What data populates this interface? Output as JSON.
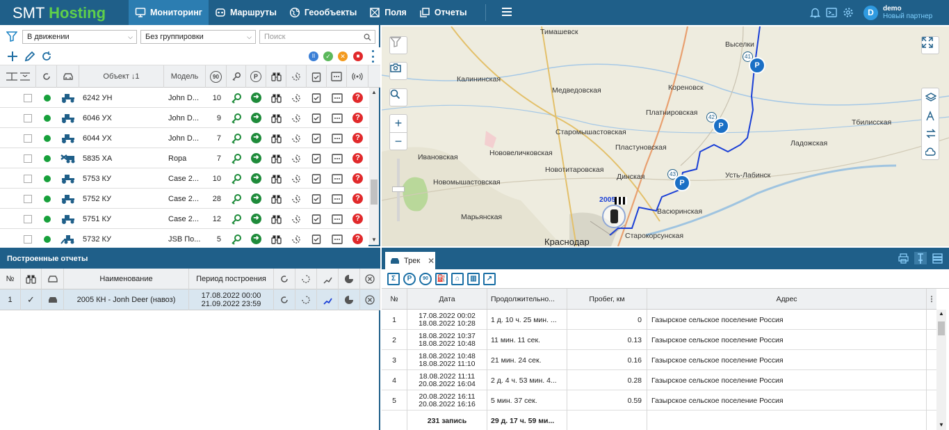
{
  "app": {
    "logo_a": "SMT ",
    "logo_b": "Hosting"
  },
  "nav": [
    {
      "label": "Мониторинг",
      "icon": "monitor-icon",
      "active": true
    },
    {
      "label": "Маршруты",
      "icon": "route-icon"
    },
    {
      "label": "Геообъекты",
      "icon": "globe-icon"
    },
    {
      "label": "Поля",
      "icon": "fields-icon"
    },
    {
      "label": "Отчеты",
      "icon": "reports-icon"
    }
  ],
  "user": {
    "initial": "D",
    "name": "demo",
    "role": "Новый партнер"
  },
  "filters": {
    "status": "В движении",
    "grouping": "Без группировки",
    "search_placeholder": "Поиск"
  },
  "objects_table": {
    "headers": {
      "object": "Объект ↓1",
      "model": "Модель",
      "speed": "90"
    },
    "rows": [
      {
        "name": "6242 УН",
        "model": "John D...",
        "val": "10",
        "icon": "tractor-icon"
      },
      {
        "name": "6046 УХ",
        "model": "John D...",
        "val": "9",
        "icon": "tractor-icon"
      },
      {
        "name": "6044 УХ",
        "model": "John D...",
        "val": "7",
        "icon": "tractor-icon"
      },
      {
        "name": "5835 ХА",
        "model": "Ropa",
        "val": "7",
        "icon": "harvester-icon"
      },
      {
        "name": "5753 КУ",
        "model": "Case 2...",
        "val": "10",
        "icon": "tractor-icon"
      },
      {
        "name": "5752 КУ",
        "model": "Case 2...",
        "val": "28",
        "icon": "tractor-icon"
      },
      {
        "name": "5751 КУ",
        "model": "Case 2...",
        "val": "12",
        "icon": "tractor-icon"
      },
      {
        "name": "5732 КУ",
        "model": "JSB По...",
        "val": "5",
        "icon": "loader-icon"
      }
    ]
  },
  "map": {
    "labels": [
      {
        "t": "Тимашевск"
      },
      {
        "t": "Выселки"
      },
      {
        "t": "Калининская"
      },
      {
        "t": "Медведовская"
      },
      {
        "t": "Кореновск"
      },
      {
        "t": "Платнировская"
      },
      {
        "t": "Тбилисская"
      },
      {
        "t": "Старомышастовская"
      },
      {
        "t": "Нововеличковская"
      },
      {
        "t": "Пластуновская"
      },
      {
        "t": "Ладожская"
      },
      {
        "t": "Ивановская"
      },
      {
        "t": "Новотитаровская"
      },
      {
        "t": "Динская"
      },
      {
        "t": "Усть-Лабинск"
      },
      {
        "t": "Новомышастовская"
      },
      {
        "t": "Васюринская"
      },
      {
        "t": "Марьянская"
      },
      {
        "t": "Краснодар"
      },
      {
        "t": "Старокорсунская"
      }
    ],
    "markers": [
      "41",
      "42",
      "43"
    ],
    "vehicle_label": "2005 КН"
  },
  "reports": {
    "title": "Построенные отчеты",
    "headers": {
      "num": "№",
      "name": "Наименование",
      "period": "Период построения"
    },
    "rows": [
      {
        "num": "1",
        "name": "2005 КН - Jonh Deer (навоз)",
        "from": "17.08.2022 00:00",
        "to": "21.09.2022 23:59"
      }
    ]
  },
  "track": {
    "tab": "Трек",
    "headers": {
      "num": "№",
      "date": "Дата",
      "duration": "Продолжительно...",
      "mileage": "Пробег, км",
      "address": "Адрес"
    },
    "rows": [
      {
        "num": "1",
        "d1": "17.08.2022 00:02",
        "d2": "18.08.2022 10:28",
        "dur": "1 д. 10 ч. 25 мин. ...",
        "km": "0",
        "addr": "Газырское сельское поселение Россия"
      },
      {
        "num": "2",
        "d1": "18.08.2022 10:37",
        "d2": "18.08.2022 10:48",
        "dur": "11 мин. 11 сек.",
        "km": "0.13",
        "addr": "Газырское сельское поселение Россия"
      },
      {
        "num": "3",
        "d1": "18.08.2022 10:48",
        "d2": "18.08.2022 11:10",
        "dur": "21 мин. 24 сек.",
        "km": "0.16",
        "addr": "Газырское сельское поселение Россия"
      },
      {
        "num": "4",
        "d1": "18.08.2022 11:11",
        "d2": "20.08.2022 16:04",
        "dur": "2 д. 4 ч. 53 мин. 4...",
        "km": "0.28",
        "addr": "Газырское сельское поселение Россия"
      },
      {
        "num": "5",
        "d1": "20.08.2022 16:11",
        "d2": "20.08.2022 16:16",
        "dur": "5 мин. 37 сек.",
        "km": "0.59",
        "addr": "Газырское сельское поселение Россия"
      }
    ],
    "total_count": "231 запись",
    "total_duration": "29 д. 17 ч. 59 ми..."
  }
}
